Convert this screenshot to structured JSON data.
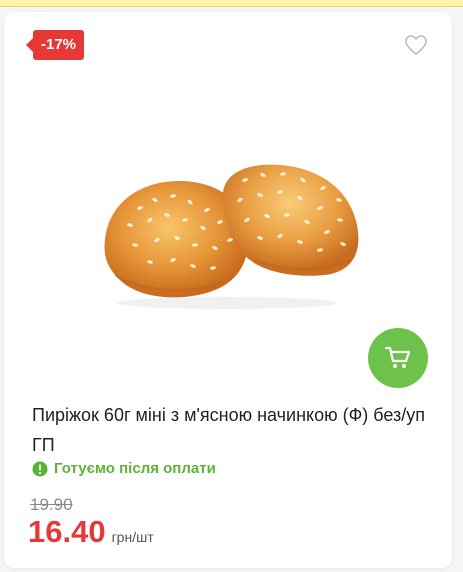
{
  "badge": {
    "discount": "-17%"
  },
  "product": {
    "title": "Пиріжок 60г міні з м'ясною начинкою (Ф) без/уп ГП",
    "status": "Готуємо після оплати",
    "old_price": "19.90",
    "price": "16.40",
    "unit": "грн/шт"
  },
  "icons": {
    "favorite": "heart-outline-icon",
    "cart": "cart-icon",
    "status": "exclamation-circle-icon"
  },
  "colors": {
    "discount": "#e53935",
    "accent_green": "#6cc24a",
    "status_green": "#5cb338",
    "price_red": "#e53935"
  }
}
